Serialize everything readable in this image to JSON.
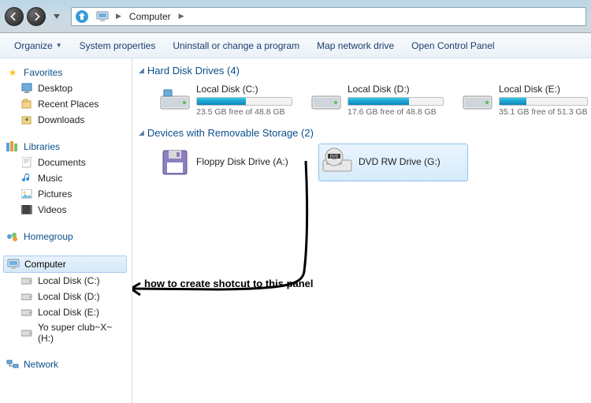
{
  "address": {
    "location": "Computer"
  },
  "toolbar": {
    "organize": "Organize",
    "system_properties": "System properties",
    "uninstall": "Uninstall or change a program",
    "map_drive": "Map network drive",
    "control_panel": "Open Control Panel"
  },
  "sidebar": {
    "favorites": {
      "label": "Favorites",
      "items": [
        "Desktop",
        "Recent Places",
        "Downloads"
      ]
    },
    "libraries": {
      "label": "Libraries",
      "items": [
        "Documents",
        "Music",
        "Pictures",
        "Videos"
      ]
    },
    "homegroup": {
      "label": "Homegroup"
    },
    "computer": {
      "label": "Computer",
      "items": [
        "Local Disk (C:)",
        "Local Disk (D:)",
        "Local Disk (E:)",
        "Yo super club~X~ (H:)"
      ]
    },
    "network": {
      "label": "Network"
    }
  },
  "sections": {
    "hdd": {
      "title": "Hard Disk Drives (4)"
    },
    "removable": {
      "title": "Devices with Removable Storage (2)"
    }
  },
  "drives": {
    "c": {
      "name": "Local Disk (C:)",
      "free": "23.5 GB free of 48.8 GB",
      "fill_pct": 52
    },
    "d": {
      "name": "Local Disk (D:)",
      "free": "17.6 GB free of 48.8 GB",
      "fill_pct": 64
    },
    "e": {
      "name": "Local Disk (E:)",
      "free": "35.1 GB free of 51.3 GB",
      "fill_pct": 31
    },
    "a": {
      "name": "Floppy Disk Drive (A:)"
    },
    "g": {
      "name": "DVD RW Drive (G:)"
    }
  },
  "annotation": {
    "text": "how to create shotcut to this panel"
  }
}
